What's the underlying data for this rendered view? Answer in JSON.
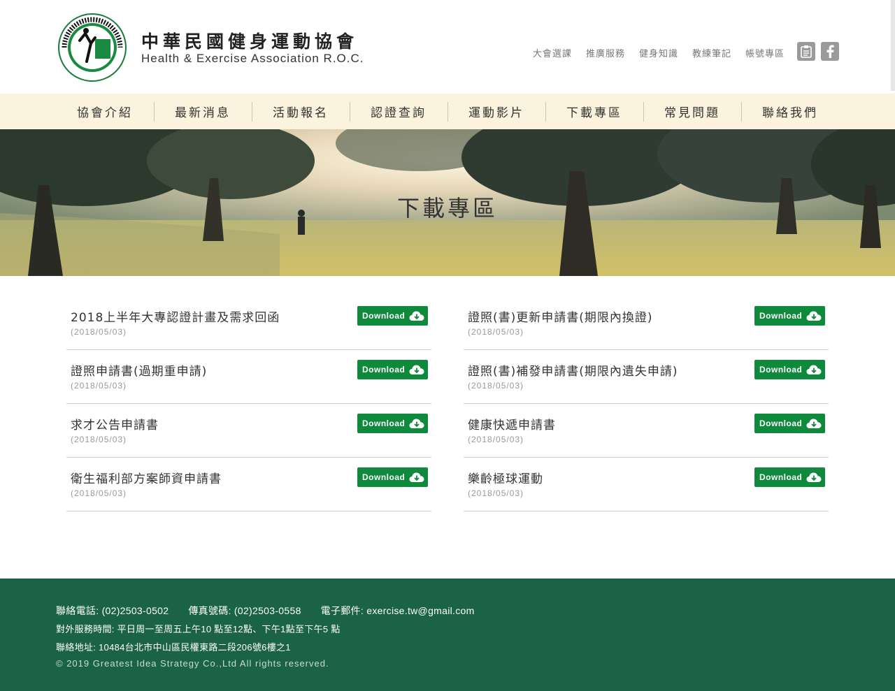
{
  "header": {
    "brand_cn": "中華民國健身運動協會",
    "brand_en": "Health & Exercise Association R.O.C.",
    "logo_ring_text": "中華民國健身運動協會 HEALTH & EXERCISE ASSOCIATION R.O.C.",
    "logo_center_text": "健康 服務 生活",
    "top_links": [
      "大會選課",
      "推廣服務",
      "健身知識",
      "教練筆記",
      "帳號專區"
    ],
    "icons": [
      "clipboard-icon",
      "facebook-icon"
    ]
  },
  "nav": {
    "items": [
      "協會介紹",
      "最新消息",
      "活動報名",
      "認證查詢",
      "運動影片",
      "下載專區",
      "常見問題",
      "聯絡我們"
    ]
  },
  "banner": {
    "title": "下載專區"
  },
  "downloads": {
    "button_label": "Download",
    "left": [
      {
        "title": "2018上半年大專認證計畫及需求回函",
        "date": "(2018/05/03)"
      },
      {
        "title": "證照申請書(過期重申請)",
        "date": "(2018/05/03)"
      },
      {
        "title": "求才公告申請書",
        "date": "(2018/05/03)"
      },
      {
        "title": "衛生福利部方案師資申請書",
        "date": "(2018/05/03)"
      }
    ],
    "right": [
      {
        "title": "證照(書)更新申請書(期限內換證)",
        "date": "(2018/05/03)"
      },
      {
        "title": "證照(書)補發申請書(期限內遺失申請)",
        "date": "(2018/05/03)"
      },
      {
        "title": "健康快遞申請書",
        "date": "(2018/05/03)"
      },
      {
        "title": "樂齡極球運動",
        "date": "(2018/05/03)"
      }
    ]
  },
  "footer": {
    "phone": "聯絡電話: (02)2503-0502",
    "fax": "傳真號碼: (02)2503-0558",
    "email": "電子郵件: exercise.tw@gmail.com",
    "hours": "對外服務時間: 平日周一至周五上午10 點至12點、下午1點至下午5 點",
    "address": "聯絡地址: 10484台北市中山區民權東路二段206號6樓之1",
    "copyright": "© 2019 Greatest Idea Strategy Co.,Ltd All rights reserved."
  },
  "colors": {
    "brand_green": "#0f8a3c",
    "footer_green": "#1b6346",
    "nav_bg": "#fbf3dd"
  }
}
